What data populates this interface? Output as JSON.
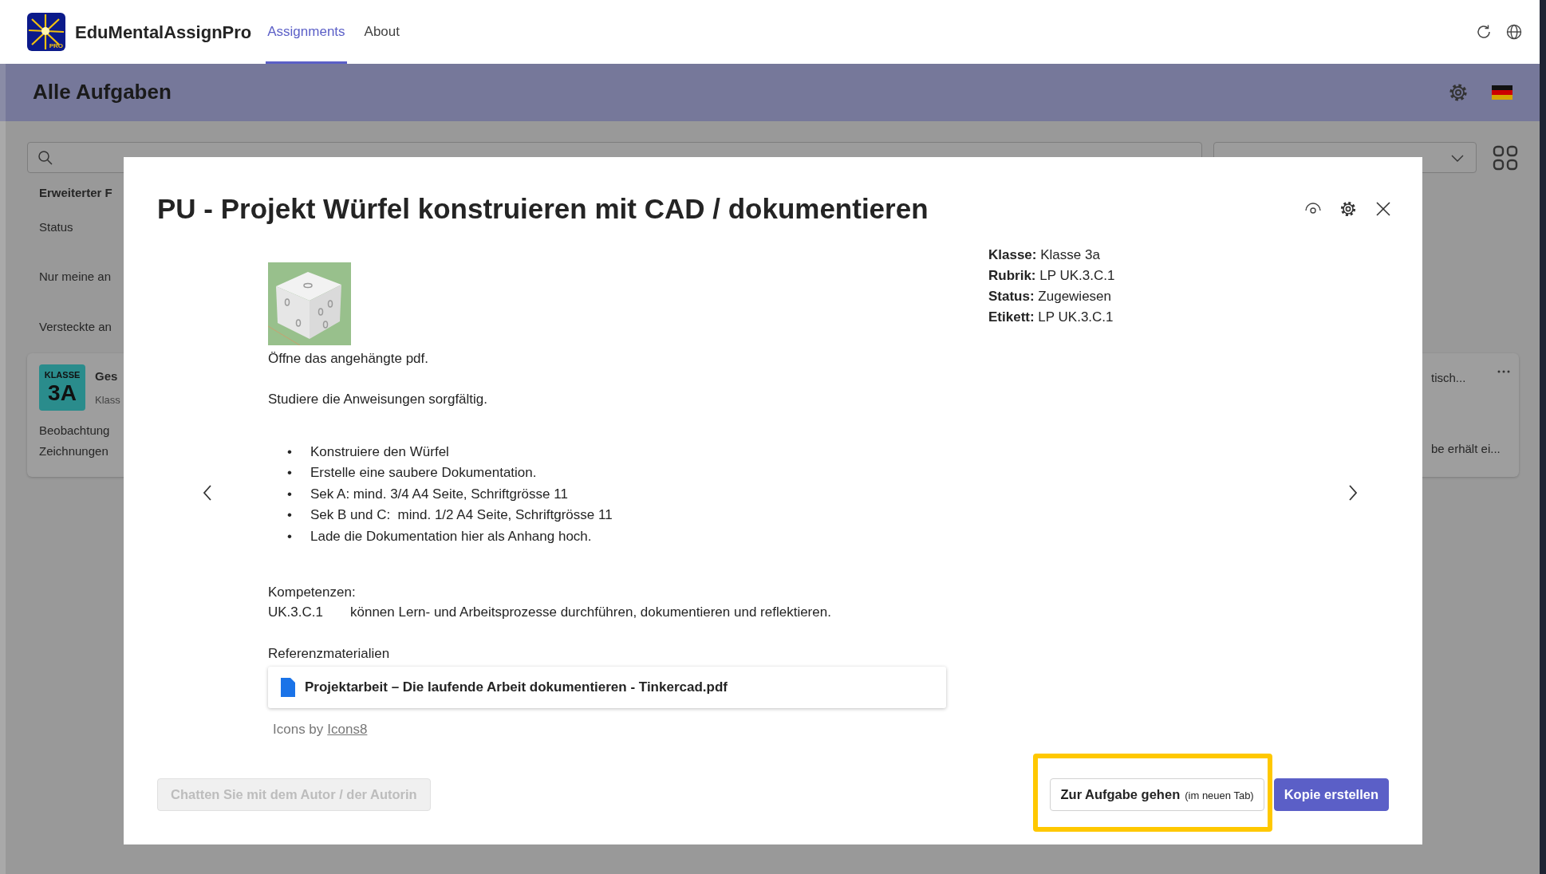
{
  "app": {
    "logo_badge": "PRO",
    "name": "EduMentalAssignPro"
  },
  "nav_tabs": [
    {
      "label": "Assignments",
      "selected": true
    },
    {
      "label": "About",
      "selected": false
    }
  ],
  "header": {
    "title": "Alle Aufgaben"
  },
  "filters": {
    "heading": "Erweiterter F",
    "items": [
      "Status",
      "Nur meine an",
      "Versteckte an"
    ]
  },
  "background_card": {
    "avatar": {
      "line_1": "KLASSE",
      "line_2": "3A"
    },
    "title": "Ges",
    "subtitle": "Klass",
    "description": [
      "Beobachtung",
      "Zeichnungen"
    ],
    "right_title": "tisch...",
    "right_description": "be erhält ei..."
  },
  "modal": {
    "title": "PU - Projekt Würfel konstruieren mit CAD / dokumentieren",
    "paragraphs": [
      "Öffne das angehängte pdf.",
      "Studiere die Anweisungen sorgfältig."
    ],
    "bullet_marker": "•",
    "bullets": [
      "Konstruiere den Würfel",
      "Erstelle eine saubere Dokumentation.",
      "Sek A: mind. 3/4 A4 Seite, Schriftgrösse 11",
      "Sek B und C:  mind. 1/2 A4 Seite, Schriftgrösse 11",
      "Lade die Dokumentation hier als Anhang hoch."
    ],
    "competencies": {
      "heading": "Kompetenzen:",
      "code": "UK.3.C.1",
      "text": "können Lern- und Arbeitsprozesse durchführen, dokumentieren und reflektieren."
    },
    "references": {
      "heading": "Referenzmaterialien",
      "files": [
        {
          "name": "Projektarbeit – Die laufende Arbeit dokumentieren - Tinkercad.pdf"
        }
      ]
    },
    "credit": {
      "text": "Icons by",
      "link": "Icons8"
    },
    "meta": [
      "**Klasse:** Klasse 3a",
      "**Rubrik:** LP UK.3.C.1",
      "**Status:** Zugewiesen",
      "**Etikett:** LP UK.3.C.1"
    ],
    "buttons": [
      {
        "label": "Chatten Sie mit dem Autor / der Autorin",
        "kind": "secondary",
        "disabled": true,
        "highlighted": false
      },
      {
        "label": "Zur Aufgabe gehen",
        "note": "(im neuen Tab)",
        "kind": "outline",
        "disabled": false,
        "highlighted": true
      },
      {
        "label": "Kopie erstellen",
        "kind": "primary",
        "disabled": false,
        "highlighted": false
      }
    ]
  }
}
